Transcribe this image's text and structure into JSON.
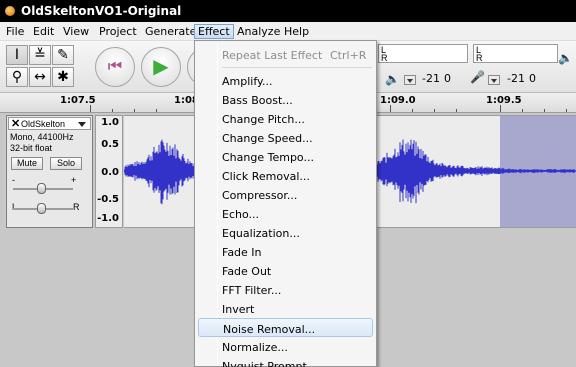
{
  "window": {
    "title": "OldSkeltonVO1-Original",
    "app_icon": "audacity-icon"
  },
  "menubar": {
    "items": [
      "File",
      "Edit",
      "View",
      "Project",
      "Generate",
      "Effect",
      "Analyze",
      "Help"
    ],
    "active": "Effect"
  },
  "toolbar": {
    "tools": {
      "ibeam": "I",
      "envelope": "≚",
      "draw": "✎",
      "zoom": "⚲",
      "timeshift": "↔",
      "multi": "✱"
    },
    "transport": {
      "skip_start": "⏮",
      "play": "▶"
    },
    "meters": {
      "L": "L",
      "R": "R",
      "db1": "-21",
      "zero1": "0",
      "db2": "-21",
      "zero2": "0"
    }
  },
  "ruler": {
    "labels": [
      "1:07.5",
      "1:08.",
      "1:09.0",
      "1:09.5"
    ]
  },
  "track": {
    "name": "OldSkelton",
    "close": "✕",
    "info1": "Mono, 44100Hz",
    "info2": "32-bit float",
    "mute": "Mute",
    "solo": "Solo",
    "gain_minus": "-",
    "gain_plus": "+",
    "pan_L": "L",
    "pan_R": "R",
    "scale": [
      "1.0",
      "0.5",
      "0.0",
      "-0.5",
      "-1.0"
    ]
  },
  "effect_menu": {
    "items": [
      {
        "label": "Repeat Last Effect",
        "shortcut": "Ctrl+R",
        "disabled": true
      },
      {
        "label": "Amplify..."
      },
      {
        "label": "Bass Boost..."
      },
      {
        "label": "Change Pitch..."
      },
      {
        "label": "Change Speed..."
      },
      {
        "label": "Change Tempo..."
      },
      {
        "label": "Click Removal..."
      },
      {
        "label": "Compressor..."
      },
      {
        "label": "Echo..."
      },
      {
        "label": "Equalization..."
      },
      {
        "label": "Fade In"
      },
      {
        "label": "Fade Out"
      },
      {
        "label": "FFT Filter..."
      },
      {
        "label": "Invert"
      },
      {
        "label": "Noise Removal...",
        "hover": true
      },
      {
        "label": "Normalize..."
      },
      {
        "label": "Nyquist Prompt..."
      }
    ]
  },
  "colors": {
    "waveform": "#3232c8",
    "selection": "#a8a8ce",
    "menu_hover": "#dbe8f7"
  }
}
